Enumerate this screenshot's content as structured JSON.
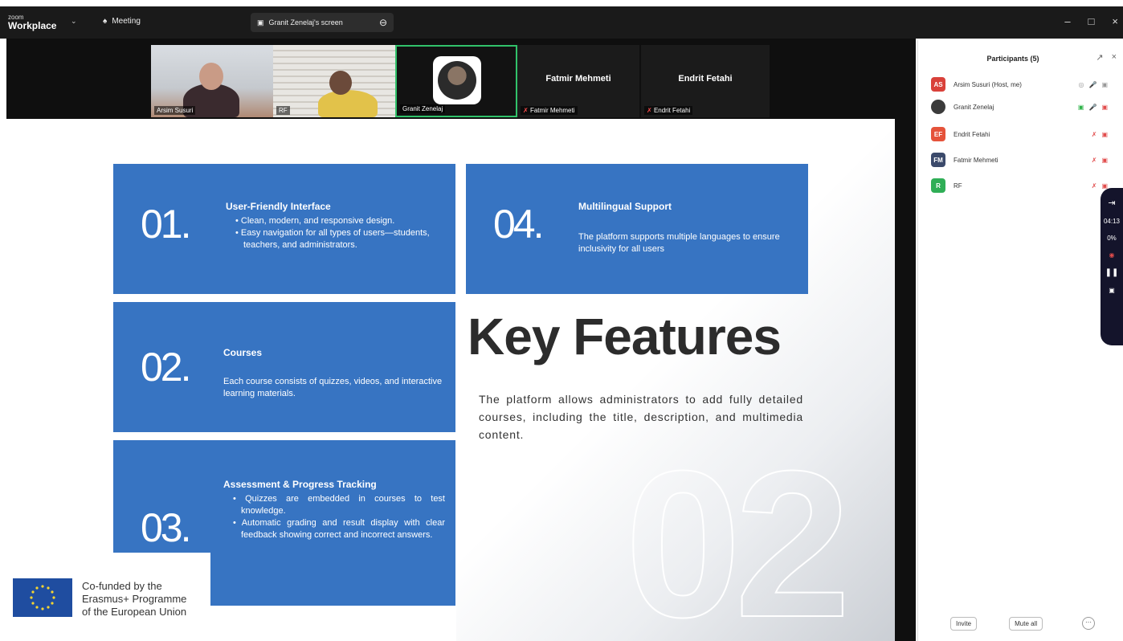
{
  "window": {
    "brand_small": "zoom",
    "brand_big": "Workplace",
    "meeting_label": "Meeting",
    "share_tab_label": "Granit Zenelaj's screen"
  },
  "gallery": [
    {
      "name": "Arsim Susuri"
    },
    {
      "name": "RF"
    },
    {
      "name": "Granit Zenelaj"
    },
    {
      "name": "Fatmir Mehmeti",
      "big_name": "Fatmir Mehmeti"
    },
    {
      "name": "Endrit Fetahi",
      "big_name": "Endrit Fetahi"
    }
  ],
  "slide": {
    "cards": [
      {
        "num": "01.",
        "title": "User-Friendly Interface",
        "bullets": [
          "• Clean, modern, and responsive design.",
          "• Easy navigation for all types of users—students, teachers, and administrators."
        ]
      },
      {
        "num": "04.",
        "title": "Multilingual Support",
        "text": "The platform supports multiple languages to ensure inclusivity for all users"
      },
      {
        "num": "02.",
        "title": "Courses",
        "text": "Each course consists of quizzes, videos, and interactive learning materials."
      },
      {
        "num": "03.",
        "title": "Assessment & Progress Tracking",
        "bullets": [
          "• Quizzes are embedded in courses to test knowledge.",
          "• Automatic grading and result display with clear feedback showing correct and incorrect answers."
        ]
      }
    ],
    "heading": "Key Features",
    "description": "The platform allows administrators to add fully detailed courses, including the title, description, and multimedia content.",
    "big_number": "02",
    "eu_line1": "Co-funded by the",
    "eu_line2": "Erasmus+ Programme",
    "eu_line3": "of the European Union"
  },
  "participants": {
    "title": "Participants (5)",
    "list": [
      {
        "initials": "AS",
        "name": "Arsim Susuri (Host, me)",
        "color": "#d9413a"
      },
      {
        "initials": "",
        "name": "Granit Zenelaj",
        "color": "#3b3b3b"
      },
      {
        "initials": "EF",
        "name": "Endrit Fetahi",
        "color": "#e5533b"
      },
      {
        "initials": "FM",
        "name": "Fatmir Mehmeti",
        "color": "#3b4a6b"
      },
      {
        "initials": "R",
        "name": "RF",
        "color": "#2fae56"
      }
    ],
    "invite_label": "Invite",
    "mute_all_label": "Mute all"
  },
  "recording": {
    "time": "04:13",
    "percent": "0%"
  }
}
